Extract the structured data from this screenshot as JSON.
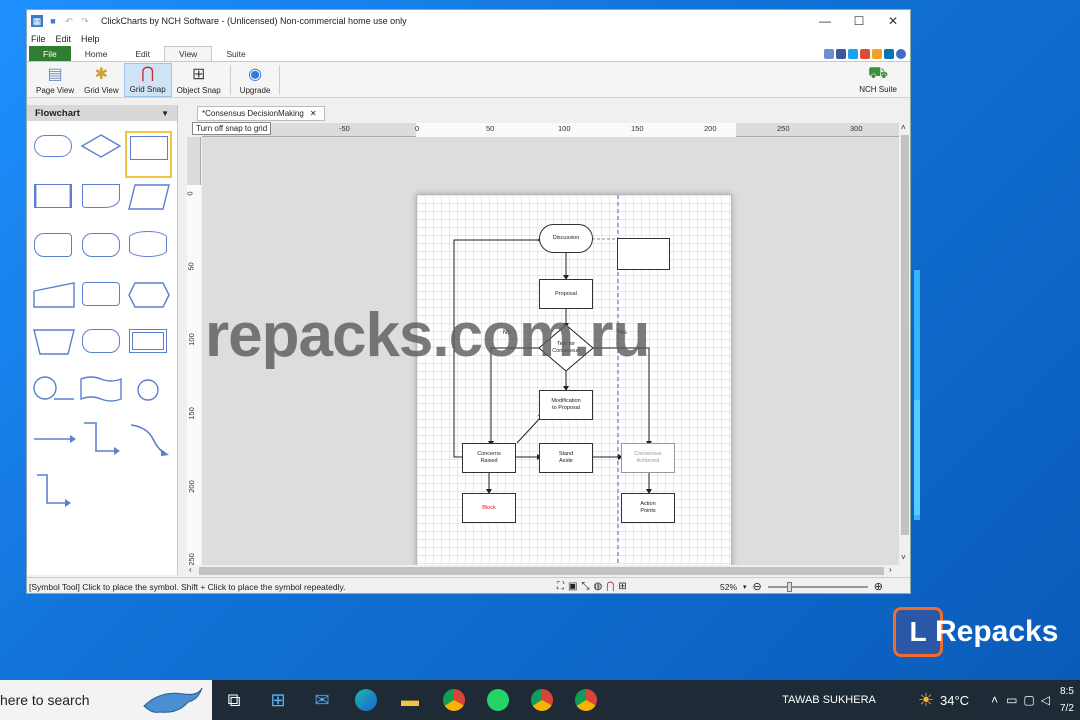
{
  "window": {
    "title": "ClickCharts by NCH Software - (Unlicensed) Non-commercial home use only",
    "controls": {
      "minimize": "—",
      "maximize": "☐",
      "close": "✕"
    }
  },
  "menubar": {
    "items": [
      "File",
      "Edit",
      "Help"
    ]
  },
  "ribbon_tabs": [
    "File",
    "Home",
    "Edit",
    "View",
    "Suite"
  ],
  "ribbon_active_tab": "View",
  "ribbon_buttons": {
    "page_view": "Page View",
    "grid_view": "Grid View",
    "grid_snap": "Grid Snap",
    "object_snap": "Object Snap",
    "upgrade": "Upgrade",
    "nch_suite": "NCH Suite"
  },
  "sidebar": {
    "title": "Flowchart",
    "dropdown": "▼"
  },
  "document_tab": {
    "label": "*Consensus DecisionMaking",
    "close": "✕"
  },
  "tooltip": "Turn off snap to grid",
  "ruler": {
    "top_labels": [
      "-50",
      "0",
      "50",
      "100",
      "150",
      "200",
      "250",
      "300"
    ],
    "left_labels": [
      "0",
      "50",
      "100",
      "150",
      "200",
      "250"
    ]
  },
  "flowchart": {
    "discussion": "Discussion",
    "proposal": "Proposal",
    "test_line1": "Test for",
    "test_line2": "Consensus",
    "no": "No",
    "yes": "Yes",
    "modification_line1": "Modification",
    "modification_line2": "to Proposal",
    "concerns_line1": "Concerns",
    "concerns_line2": "Raised",
    "stand_line1": "Stand",
    "stand_line2": "Aside",
    "consensus_line1": "Consensus",
    "consensus_line2": "Achieved",
    "block": "Block",
    "action_line1": "Action",
    "action_line2": "Points"
  },
  "statusbar": {
    "text": "[Symbol Tool] Click to place the symbol.  Shift + Click to place the symbol repeatedly.",
    "zoom": "52%",
    "zoom_level_fraction": 0.2
  },
  "watermark": "repacks.com.ru",
  "logo": {
    "letter": "L",
    "text": "Repacks"
  },
  "taskbar": {
    "search_text": "here to search",
    "user": "TAWAB SUKHERA",
    "temperature": "34°C",
    "time": "8:5",
    "date": "7/2"
  },
  "colors": {
    "accent": "#2e7d32",
    "shape_stroke": "#5b7fcf",
    "desktop": "#1273d8",
    "taskbar": "#1f2a37"
  }
}
